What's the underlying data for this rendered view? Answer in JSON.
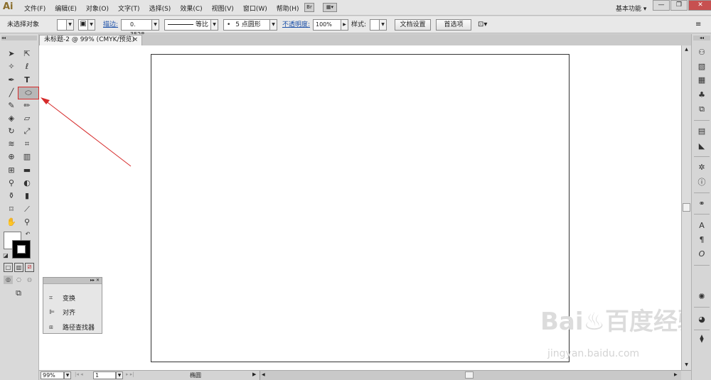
{
  "app": {
    "logo": "Ai"
  },
  "menubar": {
    "items": [
      "文件(F)",
      "编辑(E)",
      "对象(O)",
      "文字(T)",
      "选择(S)",
      "效果(C)",
      "视图(V)",
      "窗口(W)",
      "帮助(H)"
    ],
    "bridge_label": "Br",
    "workspace_label": "基本功能 ▾",
    "search_icon": "magnifier-icon"
  },
  "control": {
    "selection_status": "未选择对象",
    "stroke_label": "描边:",
    "stroke_value": "0. 3528",
    "stroke_profile": "等比",
    "brush_label": "5 点圆形",
    "opacity_label": "不透明度:",
    "opacity_value": "100%",
    "style_label": "样式:",
    "doc_setup": "文档设置",
    "prefs": "首选项"
  },
  "document": {
    "tab_title": "未标题-2 @ 99% (CMYK/预览)",
    "tab_close": "×"
  },
  "status": {
    "zoom": "99%",
    "page": "1",
    "tool_name": "椭圆"
  },
  "float_panel": {
    "items": [
      {
        "label": "变换",
        "icon": "transform-icon"
      },
      {
        "label": "对齐",
        "icon": "align-icon"
      },
      {
        "label": "路径查找器",
        "icon": "pathfinder-icon"
      }
    ]
  },
  "watermark": {
    "main": "Bai♨百度经验",
    "url": "jingyan.baidu.com"
  },
  "colors": {
    "annotation_red": "#d62b2b",
    "fill": "#ffffff",
    "stroke": "#000000"
  }
}
